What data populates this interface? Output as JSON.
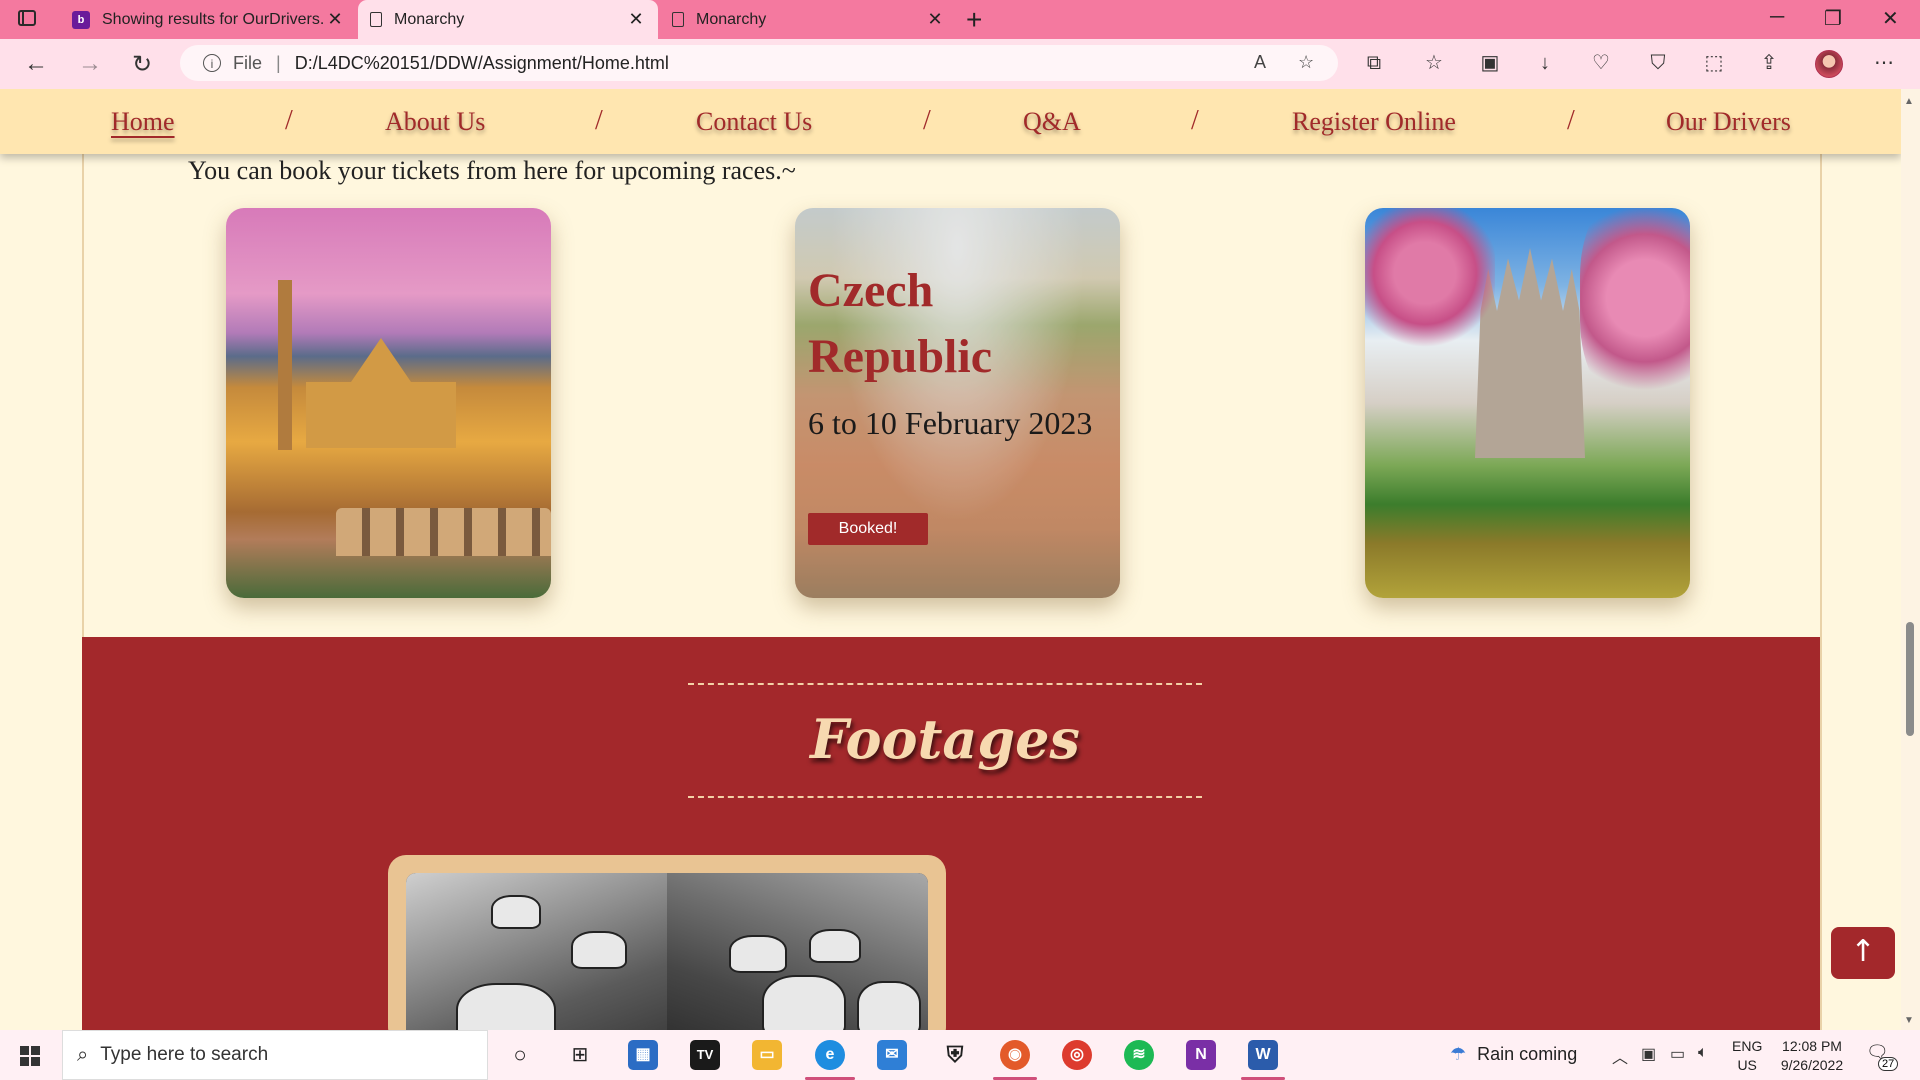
{
  "browser": {
    "tabs": [
      {
        "label": "Showing results for OurDrivers.h",
        "icon": "bb-site-icon"
      },
      {
        "label": "Monarchy",
        "icon": "page-icon",
        "active": true
      },
      {
        "label": "Monarchy",
        "icon": "page-icon"
      }
    ],
    "new_tab": "+",
    "url_prefix": "File",
    "url": "D:/L4DC%20151/DDW/Assignment/Home.html"
  },
  "nav": {
    "links": [
      "Home",
      "About Us",
      "Contact Us",
      "Q&A",
      "Register Online",
      "Our Drivers"
    ],
    "separator": "/",
    "active": "Home"
  },
  "races": {
    "intro": "You can book your tickets from here for upcoming races.~",
    "featured": {
      "country": "Czech Republic",
      "dates": "6 to 10 February 2023",
      "button": "Booked!"
    }
  },
  "footage": {
    "title": "Footages"
  },
  "back_to_top": "↑",
  "taskbar": {
    "search_placeholder": "Type here to search",
    "weather": "Rain coming",
    "language": "ENG",
    "region": "US",
    "time": "12:08 PM",
    "date": "9/26/2022",
    "notifications": "27"
  },
  "colors": {
    "tab_bar": "#f4799f",
    "nav_bg": "#ffe6b0",
    "accent_red": "#a3282b",
    "page_bg": "#fff7de"
  }
}
